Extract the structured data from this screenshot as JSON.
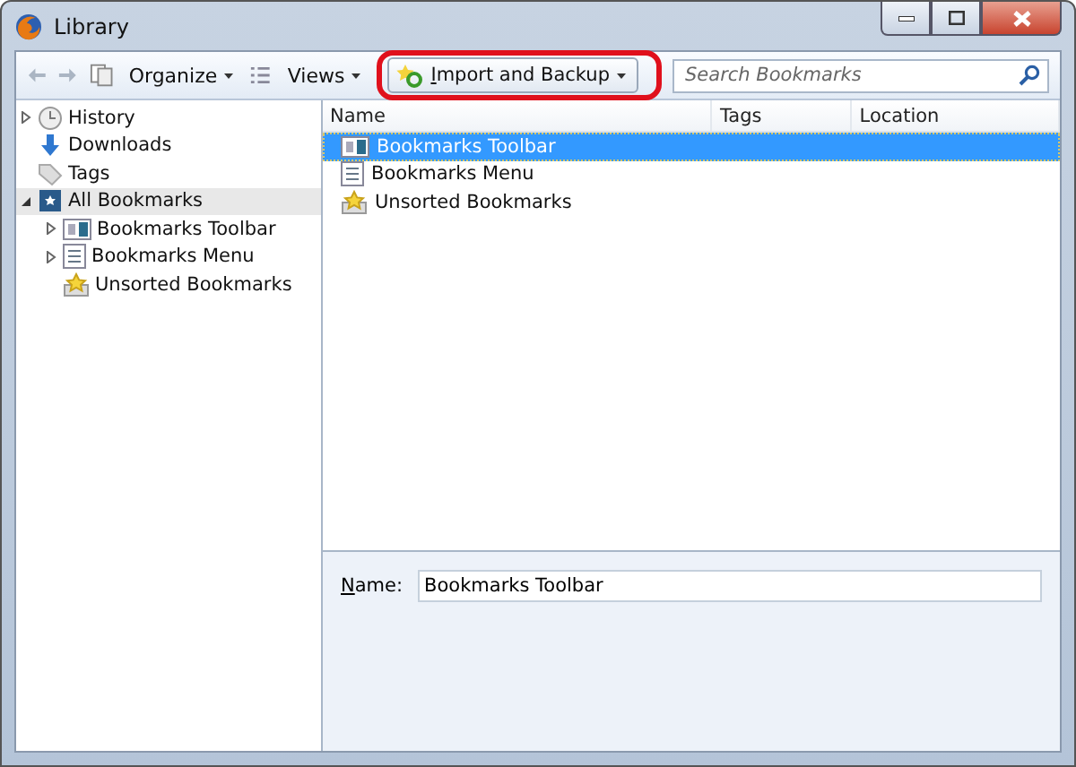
{
  "window": {
    "title": "Library"
  },
  "toolbar": {
    "organize": "Organize",
    "views": "Views",
    "import_backup": "Import and Backup",
    "highlighted": true,
    "search": {
      "placeholder": "Search Bookmarks"
    }
  },
  "sidebar": {
    "items": [
      {
        "label": "History",
        "kind": "history",
        "expanded": false,
        "selected": false
      },
      {
        "label": "Downloads",
        "kind": "downloads",
        "selected": false
      },
      {
        "label": "Tags",
        "kind": "tags",
        "selected": false
      },
      {
        "label": "All Bookmarks",
        "kind": "all",
        "expanded": true,
        "selected": true,
        "children": [
          {
            "label": "Bookmarks Toolbar",
            "kind": "toolbar",
            "expanded": false,
            "selected": false
          },
          {
            "label": "Bookmarks Menu",
            "kind": "menu",
            "expanded": false,
            "selected": false
          },
          {
            "label": "Unsorted Bookmarks",
            "kind": "unsorted",
            "selected": false
          }
        ]
      }
    ]
  },
  "table": {
    "columns": [
      "Name",
      "Tags",
      "Location"
    ],
    "rows": [
      {
        "name": "Bookmarks Toolbar",
        "kind": "toolbar",
        "selected": true
      },
      {
        "name": "Bookmarks Menu",
        "kind": "menu",
        "selected": false
      },
      {
        "name": "Unsorted Bookmarks",
        "kind": "unsorted",
        "selected": false
      }
    ]
  },
  "details": {
    "label": "Name:",
    "value": "Bookmarks Toolbar"
  }
}
